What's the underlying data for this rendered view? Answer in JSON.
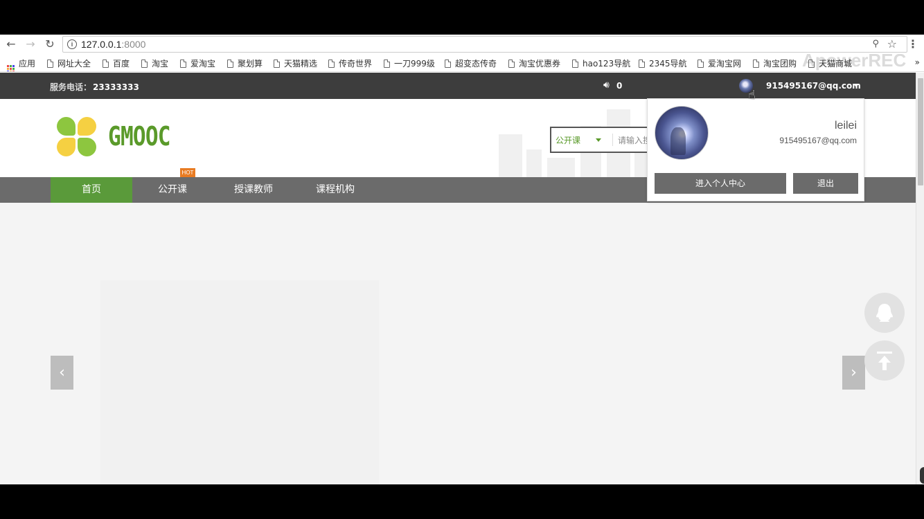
{
  "browser": {
    "url_host": "127.0.0.1",
    "url_port": ":8000",
    "back_icon": "back-arrow-icon",
    "forward_icon": "forward-arrow-icon",
    "reload_icon": "reload-icon",
    "bookmarks": [
      {
        "label": "应用",
        "icon": "apps-grid-icon"
      },
      {
        "label": "网址大全"
      },
      {
        "label": "百度"
      },
      {
        "label": "淘宝"
      },
      {
        "label": "爱淘宝"
      },
      {
        "label": "聚划算"
      },
      {
        "label": "天猫精选"
      },
      {
        "label": "传奇世界"
      },
      {
        "label": "一刀999级"
      },
      {
        "label": "超变态传奇"
      },
      {
        "label": "淘宝优惠券"
      },
      {
        "label": "hao123导航"
      },
      {
        "label": "2345导航"
      },
      {
        "label": "爱淘宝网"
      },
      {
        "label": "淘宝团购"
      },
      {
        "label": "天猫商城"
      }
    ],
    "more": "»",
    "watermark": "ApowerREC"
  },
  "topbar": {
    "service_label": "服务电话：",
    "service_number": "23333333",
    "message_count": "0",
    "user_email": "915495167@qq.com"
  },
  "header": {
    "logo_text": "GMOOC",
    "hot_badge": "HOT",
    "search": {
      "type": "公开课",
      "placeholder": "请输入搜"
    }
  },
  "nav": {
    "items": [
      {
        "label": "首页",
        "active": true
      },
      {
        "label": "公开课"
      },
      {
        "label": "授课教师"
      },
      {
        "label": "课程机构"
      }
    ]
  },
  "banner": {
    "prev": "‹",
    "next": "›"
  },
  "dropdown": {
    "username": "leilei",
    "email": "915495167@qq.com",
    "center_button": "进入个人中心",
    "logout_button": "退出"
  },
  "colors": {
    "accent_green": "#5a9a3a",
    "topbar_bg": "#3d3d3d",
    "navbar_bg": "#6b6b6b",
    "hot_orange": "#e87b22"
  }
}
